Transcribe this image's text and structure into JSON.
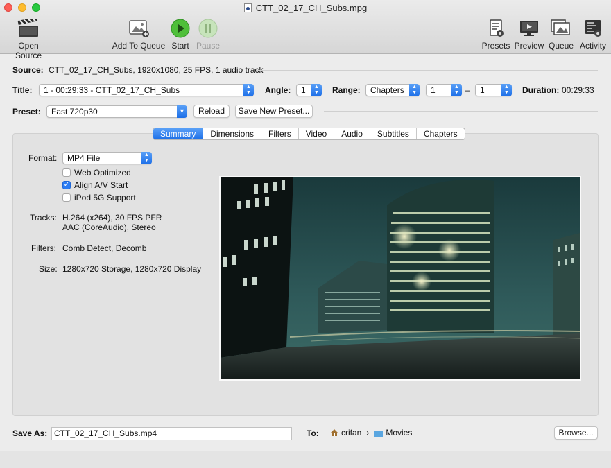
{
  "window": {
    "title": "CTT_02_17_CH_Subs.mpg"
  },
  "toolbar": {
    "open_source": "Open Source",
    "add_to_queue": "Add To Queue",
    "start": "Start",
    "pause": "Pause",
    "presets": "Presets",
    "preview": "Preview",
    "queue": "Queue",
    "activity": "Activity"
  },
  "source": {
    "label": "Source:",
    "value": "CTT_02_17_CH_Subs, 1920x1080, 25 FPS, 1 audio track"
  },
  "title_row": {
    "label": "Title:",
    "value": "1 - 00:29:33 - CTT_02_17_CH_Subs",
    "angle_label": "Angle:",
    "angle_value": "1",
    "range_label": "Range:",
    "range_type": "Chapters",
    "range_start": "1",
    "range_sep": "–",
    "range_end": "1",
    "duration_label": "Duration:",
    "duration_value": "00:29:33"
  },
  "preset_row": {
    "label": "Preset:",
    "value": "Fast 720p30",
    "reload": "Reload",
    "save_new": "Save New Preset..."
  },
  "tabs": [
    "Summary",
    "Dimensions",
    "Filters",
    "Video",
    "Audio",
    "Subtitles",
    "Chapters"
  ],
  "summary": {
    "format_label": "Format:",
    "format_value": "MP4 File",
    "web_optimized": "Web Optimized",
    "web_optimized_checked": false,
    "align_av": "Align A/V Start",
    "align_av_checked": true,
    "ipod": "iPod 5G Support",
    "ipod_checked": false,
    "tracks_label": "Tracks:",
    "tracks_line1": "H.264 (x264), 30 FPS PFR",
    "tracks_line2": "AAC (CoreAudio), Stereo",
    "filters_label": "Filters:",
    "filters_value": "Comb Detect, Decomb",
    "size_label": "Size:",
    "size_value": "1280x720 Storage, 1280x720 Display"
  },
  "save": {
    "label": "Save As:",
    "value": "CTT_02_17_CH_Subs.mp4",
    "to_label": "To:",
    "path_user": "crifan",
    "path_sep": "›",
    "path_folder": "Movies",
    "browse": "Browse..."
  },
  "colors": {
    "accent": "#1d6fe8",
    "start_green": "#3cb043"
  }
}
